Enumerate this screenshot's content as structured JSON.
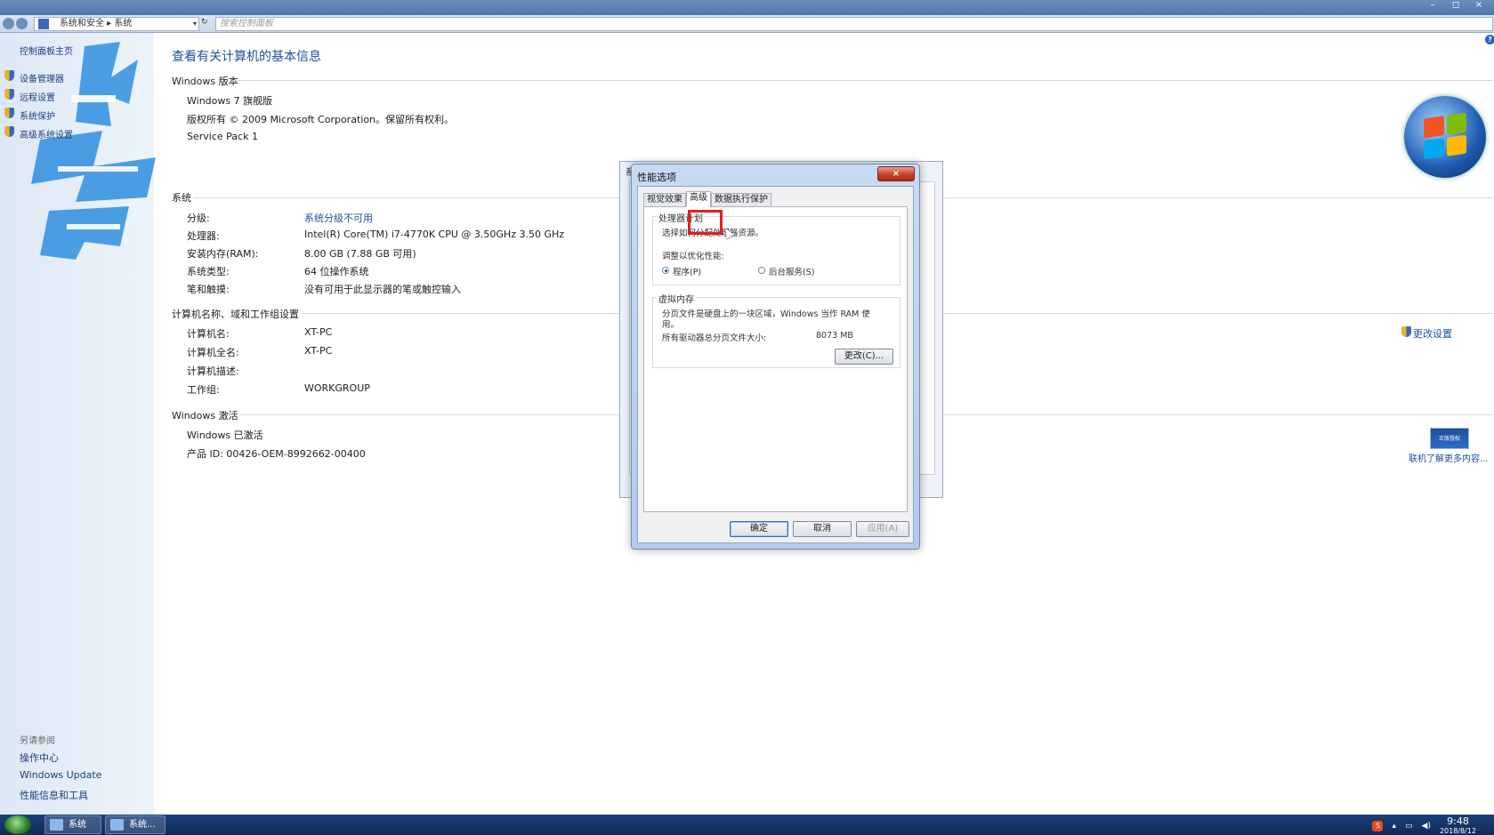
{
  "titlebar": {
    "minimize": "–",
    "maximize": "◻",
    "close": "×"
  },
  "addressbar": {
    "breadcrumb": "系统和安全 ▸ 系统",
    "search_placeholder": "搜索控制面板",
    "refresh": "↻"
  },
  "leftpane": {
    "home": "控制面板主页",
    "links": [
      "设备管理器",
      "远程设置",
      "系统保护",
      "高级系统设置"
    ],
    "see_also_head": "另请参阅",
    "see_also": [
      "操作中心",
      "Windows Update",
      "性能信息和工具"
    ]
  },
  "main": {
    "title": "查看有关计算机的基本信息",
    "edition_head": "Windows 版本",
    "edition": "Windows 7 旗舰版",
    "copyright": "版权所有 © 2009 Microsoft Corporation。保留所有权利。",
    "service_pack": "Service Pack 1",
    "system_head": "系统",
    "system_rows": [
      {
        "label": "分级:",
        "value": "系统分级不可用"
      },
      {
        "label": "处理器:",
        "value": "Intel(R) Core(TM) i7-4770K CPU @ 3.50GHz   3.50 GHz"
      },
      {
        "label": "安装内存(RAM):",
        "value": "8.00 GB (7.88 GB 可用)"
      },
      {
        "label": "系统类型:",
        "value": "64 位操作系统"
      },
      {
        "label": "笔和触摸:",
        "value": "没有可用于此显示器的笔或触控输入"
      }
    ],
    "computer_head": "计算机名称、域和工作组设置",
    "computer_rows": [
      {
        "label": "计算机名:",
        "value": "XT-PC"
      },
      {
        "label": "计算机全名:",
        "value": "XT-PC"
      },
      {
        "label": "计算机描述:",
        "value": ""
      },
      {
        "label": "工作组:",
        "value": "WORKGROUP"
      }
    ],
    "change_settings": "更改设置",
    "activation_head": "Windows 激活",
    "activated": "Windows 已激活",
    "product_id": "产品 ID: 00426-OEM-8992662-00400",
    "learn_more": "联机了解更多内容...",
    "genuine_badge": "正版授权"
  },
  "bgdialog": {
    "title": "系"
  },
  "dialog": {
    "title": "性能选项",
    "close": "×",
    "tabs": [
      "视觉效果",
      "高级",
      "数据执行保护"
    ],
    "active_tab": 1,
    "processor_group": "处理器计划",
    "processor_desc": "选择如何分配处理器资源。",
    "optimize_label": "调整以优化性能:",
    "radio_programs": "程序(P)",
    "radio_services": "后台服务(S)",
    "selected_radio": "programs",
    "vm_group": "虚拟内存",
    "vm_desc_1": "分页文件是硬盘上的一块区域，Windows 当作 RAM 使",
    "vm_desc_2": "用。",
    "vm_total_label": "所有驱动器总分页文件大小:",
    "vm_total_value": "8073 MB",
    "change_button": "更改(C)...",
    "ok": "确定",
    "cancel": "取消",
    "apply": "应用(A)"
  },
  "taskbar": {
    "tasks": [
      "系统",
      "系统..."
    ],
    "time": "9:48",
    "date": "2018/8/12",
    "ime": "S"
  }
}
